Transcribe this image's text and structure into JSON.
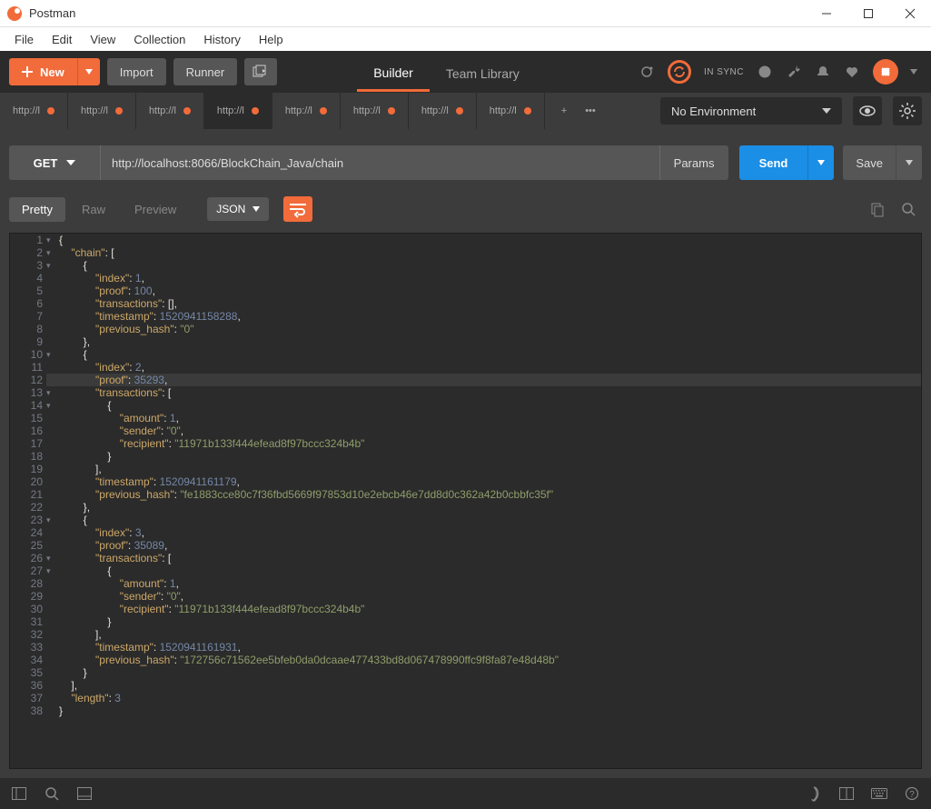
{
  "window": {
    "title": "Postman"
  },
  "menu": [
    "File",
    "Edit",
    "View",
    "Collection",
    "History",
    "Help"
  ],
  "toolbar": {
    "new_label": "New",
    "import_label": "Import",
    "runner_label": "Runner",
    "builder_tab": "Builder",
    "team_tab": "Team Library",
    "sync_label": "IN SYNC"
  },
  "tabs": {
    "items": [
      {
        "label": "http://l",
        "dirty": true
      },
      {
        "label": "http://l",
        "dirty": true
      },
      {
        "label": "http://l",
        "dirty": true
      },
      {
        "label": "http://l",
        "dirty": true,
        "active": true
      },
      {
        "label": "http://l",
        "dirty": true
      },
      {
        "label": "http://l",
        "dirty": true
      },
      {
        "label": "http://l",
        "dirty": true
      },
      {
        "label": "http://l",
        "dirty": true
      }
    ]
  },
  "environment": {
    "selected": "No Environment"
  },
  "request": {
    "method": "GET",
    "url": "http://localhost:8066/BlockChain_Java/chain",
    "params": "Params",
    "send": "Send",
    "save": "Save"
  },
  "response": {
    "view_pretty": "Pretty",
    "view_raw": "Raw",
    "view_preview": "Preview",
    "format": "JSON",
    "highlighted_line": 12,
    "body": {
      "chain": [
        {
          "index": 1,
          "proof": 100,
          "transactions": [],
          "timestamp": 1520941158288,
          "previous_hash": "0"
        },
        {
          "index": 2,
          "proof": 35293,
          "transactions": [
            {
              "amount": 1,
              "sender": "0",
              "recipient": "11971b133f444efead8f97bccc324b4b"
            }
          ],
          "timestamp": 1520941161179,
          "previous_hash": "fe1883cce80c7f36fbd5669f97853d10e2ebcb46e7dd8d0c362a42b0cbbfc35f"
        },
        {
          "index": 3,
          "proof": 35089,
          "transactions": [
            {
              "amount": 1,
              "sender": "0",
              "recipient": "11971b133f444efead8f97bccc324b4b"
            }
          ],
          "timestamp": 1520941161931,
          "previous_hash": "172756c71562ee5bfeb0da0dcaae477433bd8d067478990ffc9f8fa87e48d48b"
        }
      ],
      "length": 3
    }
  }
}
